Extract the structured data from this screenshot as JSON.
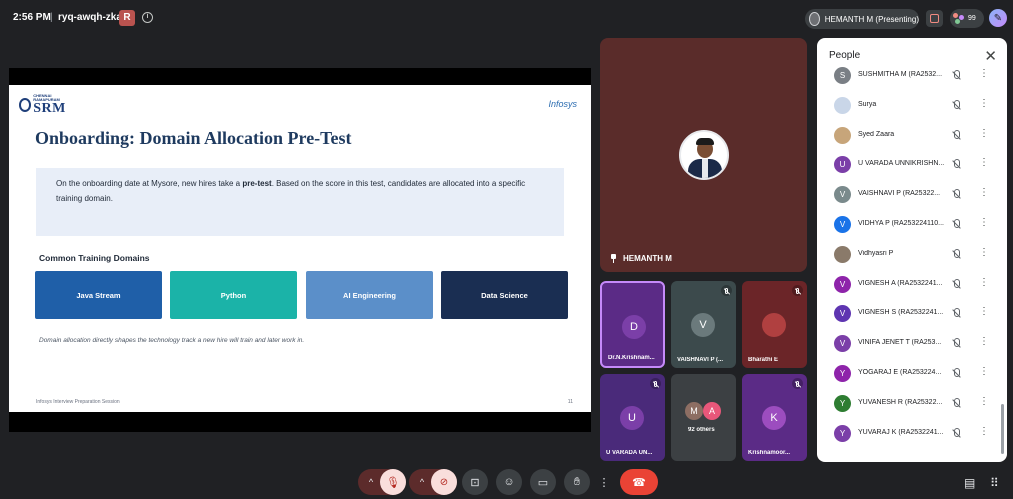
{
  "topbar": {
    "time": "2:56 PM",
    "separator": "|",
    "meeting_code": "ryq-awqh-zka",
    "badge_letter": "R",
    "presenting_label": "HEMANTH M (Presenting)",
    "participant_count": "99"
  },
  "slide": {
    "logo_top": "CHENNAI RAMAPURAM",
    "logo_main": "SRM",
    "partner_logo": "Infosys",
    "title": "Onboarding: Domain Allocation Pre-Test",
    "callout_pre": "On the onboarding date at Mysore, new hires take a ",
    "callout_bold": "pre-test",
    "callout_post": ". Based on the score in this test, candidates are allocated into a specific training domain.",
    "domains_heading": "Common Training Domains",
    "domains": [
      {
        "label": "Java Stream",
        "color": "#1f5fa8"
      },
      {
        "label": "Python",
        "color": "#1bb3a8"
      },
      {
        "label": "AI Engineering",
        "color": "#5b8fc9"
      },
      {
        "label": "Data Science",
        "color": "#1a2e52"
      }
    ],
    "footnote": "Domain allocation directly shapes the technology track a new hire will train and later work in.",
    "footer": "Infosys Interview Preparation Session",
    "page_number": "11"
  },
  "main_tile": {
    "name": "HEMANTH M",
    "background": "#5a2c2a"
  },
  "tiles": [
    {
      "initial": "D",
      "label": "Dr.N.Krishnam...",
      "bg": "#5b2b86",
      "avatar": "#7b3fa8",
      "muted": false,
      "active": true
    },
    {
      "initial": "V",
      "label": "VAISHNAVI P (...",
      "bg": "#3c4a4c",
      "avatar": "#6b7a7c",
      "muted": true,
      "active": false
    },
    {
      "initial": "",
      "label": "Bharathi E",
      "bg": "#6b2528",
      "avatar": "#b04040",
      "muted": true,
      "active": false
    },
    {
      "initial": "U",
      "label": "U VARADA UN...",
      "bg": "#4a2a7a",
      "avatar": "#7b3fa8",
      "muted": true,
      "active": false
    },
    {
      "initial": "",
      "label": "92 others",
      "bg": "#3c4043",
      "avatar": "",
      "muted": false,
      "active": false
    },
    {
      "initial": "K",
      "label": "Krishnamoor...",
      "bg": "#5b2b86",
      "avatar": "#9c4dbf",
      "muted": true,
      "active": false
    }
  ],
  "others_avatars": [
    "M",
    "A"
  ],
  "people": {
    "title": "People",
    "close": "✕",
    "list": [
      {
        "initial": "S",
        "name": "SUSHMITHA M (RA2532...",
        "color": "#7a7f85"
      },
      {
        "initial": "",
        "name": "Surya",
        "color": "#c9d6e8"
      },
      {
        "initial": "",
        "name": "Syed Zaara",
        "color": "#c7a57a"
      },
      {
        "initial": "U",
        "name": "U VARADA UNNIKRISHN...",
        "color": "#7b3fa8"
      },
      {
        "initial": "V",
        "name": "VAISHNAVI P (RA25322...",
        "color": "#7a8a8c"
      },
      {
        "initial": "V",
        "name": "VIDHYA P (RA253224110...",
        "color": "#1a73e8"
      },
      {
        "initial": "",
        "name": "Vidhyasri P",
        "color": "#8a7a6a"
      },
      {
        "initial": "V",
        "name": "VIGNESH A (RA2532241...",
        "color": "#8e24aa"
      },
      {
        "initial": "V",
        "name": "VIGNESH S (RA2532241...",
        "color": "#5e35b1"
      },
      {
        "initial": "V",
        "name": "VINIFA JENET T (RA253...",
        "color": "#7b3fa8"
      },
      {
        "initial": "Y",
        "name": "YOGARAJ E (RA253224...",
        "color": "#8e24aa"
      },
      {
        "initial": "Y",
        "name": "YUVANESH R (RA25322...",
        "color": "#2e7d32"
      },
      {
        "initial": "Y",
        "name": "YUVARAJ K (RA2532241...",
        "color": "#7b3fa8"
      }
    ]
  },
  "controls": {
    "chevron": "^",
    "more": "⋮"
  }
}
